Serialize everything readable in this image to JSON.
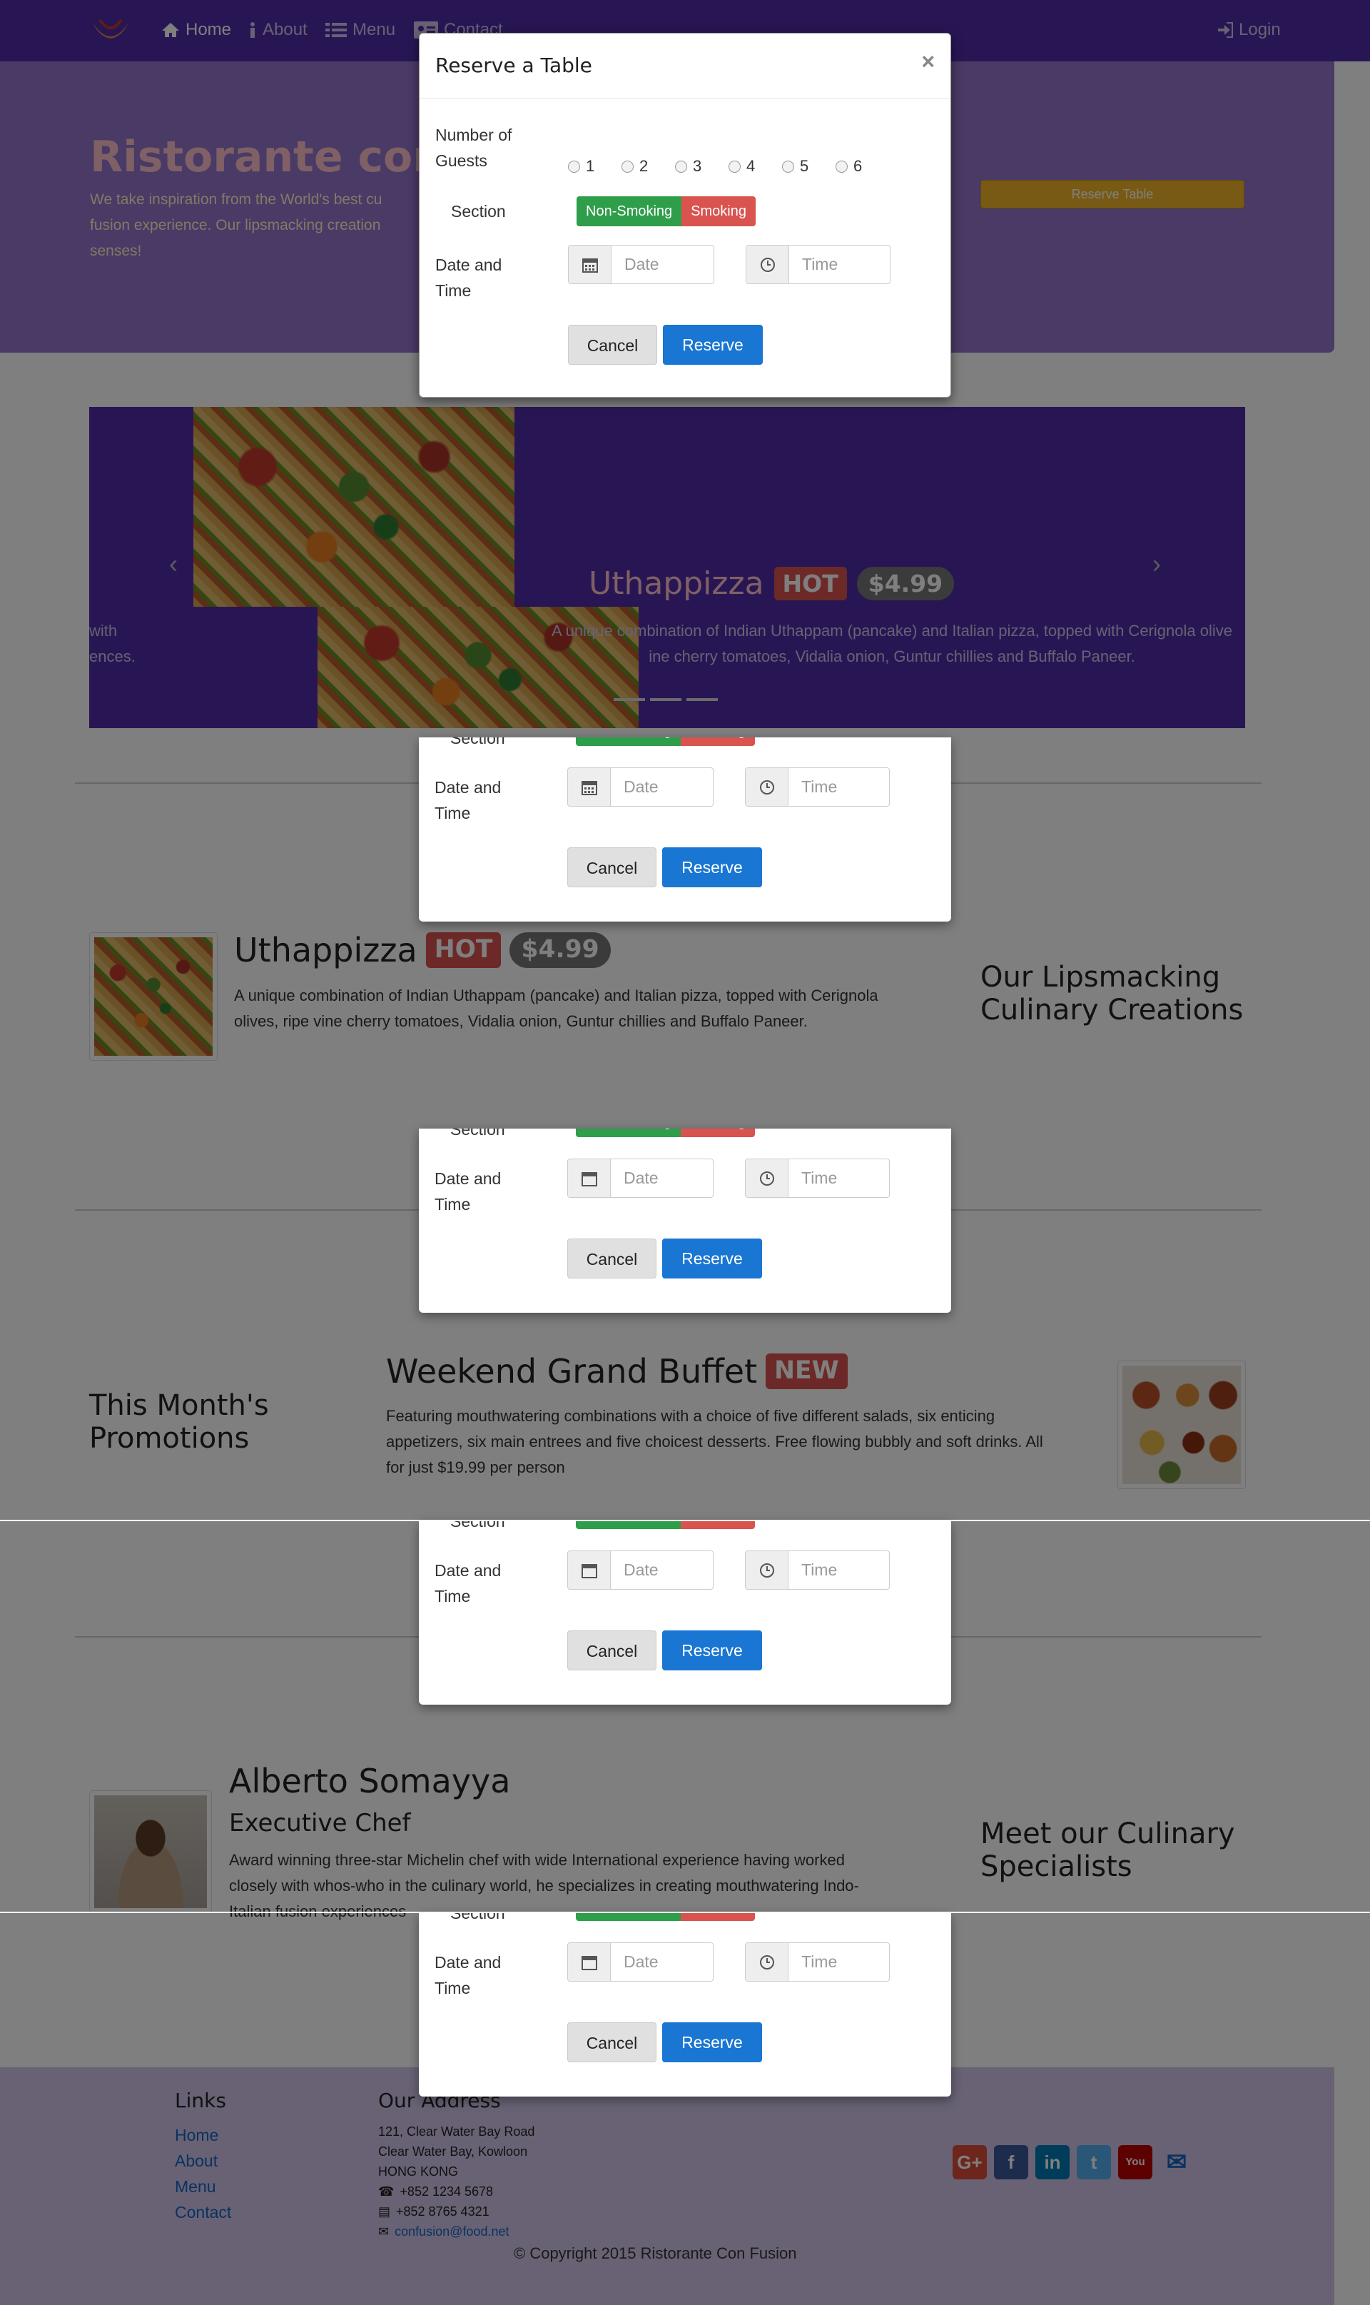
{
  "nav": {
    "home": "Home",
    "about": "About",
    "menu": "Menu",
    "contact": "Contact",
    "login": "Login"
  },
  "jumbotron": {
    "title": "Ristorante con Fusion",
    "text_line1": "We take inspiration from the World's best cu",
    "text_line2": "fusion experience. Our lipsmacking creation",
    "text_line3": "senses!",
    "reserve_button": "Reserve Table"
  },
  "carousel": {
    "title": "Uthappizza",
    "badge": "HOT",
    "price": "$4.99",
    "caption_line1": "A unique combination of Indian Uthappam (pancake) and Italian pizza, topped with Cerignola olive",
    "caption_line2": "ine cherry tomatoes, Vidalia onion, Guntur chillies and Buffalo Paneer.",
    "left_fragment_line1": "with",
    "left_fragment_line2": "ences."
  },
  "dish": {
    "title": "Uthappizza",
    "badge": "HOT",
    "price": "$4.99",
    "desc_line1": "A unique combination of Indian Uthappam (pancake) and Italian pizza, topped with Cerignola",
    "desc_line2": "olives, ripe vine cherry tomatoes, Vidalia onion, Guntur chillies and Buffalo Paneer.",
    "heading_line1": "Our Lipsmacking",
    "heading_line2": "Culinary Creations"
  },
  "promotion": {
    "heading_line1": "This Month's",
    "heading_line2": "Promotions",
    "title": "Weekend Grand Buffet",
    "badge": "NEW",
    "desc_line1": "Featuring mouthwatering combinations with a choice of five different salads, six enticing",
    "desc_line2": "appetizers, six main entrees and five choicest desserts. Free flowing bubbly and soft drinks. All",
    "desc_line3": "for just $19.99 per person"
  },
  "leader": {
    "name": "Alberto Somayya",
    "role": "Executive Chef",
    "desc_line1": "Award winning three-star Michelin chef with wide International experience having worked",
    "desc_line2": "closely with whos-who in the culinary world, he specializes in creating mouthwatering Indo-",
    "desc_line3": "Italian fusion experiences",
    "heading_line1": "Meet our Culinary",
    "heading_line2": "Specialists"
  },
  "footer": {
    "links_heading": "Links",
    "links": [
      "Home",
      "About",
      "Menu",
      "Contact"
    ],
    "address_heading": "Our Address",
    "address_line1": "121, Clear Water Bay Road",
    "address_line2": "Clear Water Bay, Kowloon",
    "address_line3": "HONG KONG",
    "phone": "+852 1234 5678",
    "fax": "+852 8765 4321",
    "email": "confusion@food.net",
    "copyright": "© Copyright 2015 Ristorante Con Fusion",
    "social": [
      {
        "name": "google-plus-icon",
        "glyph": "G+",
        "color": "#dd4b39"
      },
      {
        "name": "facebook-icon",
        "glyph": "f",
        "color": "#3b5998"
      },
      {
        "name": "linkedin-icon",
        "glyph": "in",
        "color": "#007bb5"
      },
      {
        "name": "twitter-icon",
        "glyph": "t",
        "color": "#55acee"
      },
      {
        "name": "youtube-icon",
        "glyph": "You",
        "color": "#bb0000"
      }
    ]
  },
  "modal": {
    "title": "Reserve a Table",
    "close": "×",
    "guests_label_line1": "Number of",
    "guests_label_line2": "Guests",
    "guest_options": [
      "1",
      "2",
      "3",
      "4",
      "5",
      "6"
    ],
    "section_label": "Section",
    "section_options": [
      "Non-Smoking",
      "Smoking"
    ],
    "datetime_label_line1": "Date and",
    "datetime_label_line2": "Time",
    "date_placeholder": "Date",
    "time_placeholder": "Time",
    "cancel_label": "Cancel",
    "reserve_label": "Reserve"
  },
  "colors": {
    "navbar": "#512da8",
    "jumbotron": "#9575cd",
    "footer": "#d1c4e9",
    "hot_badge": "#d9534f",
    "price_badge": "#777777",
    "primary_button": "#1976d2",
    "non_smoking": "#2e9e4a",
    "smoking": "#d9534f"
  }
}
